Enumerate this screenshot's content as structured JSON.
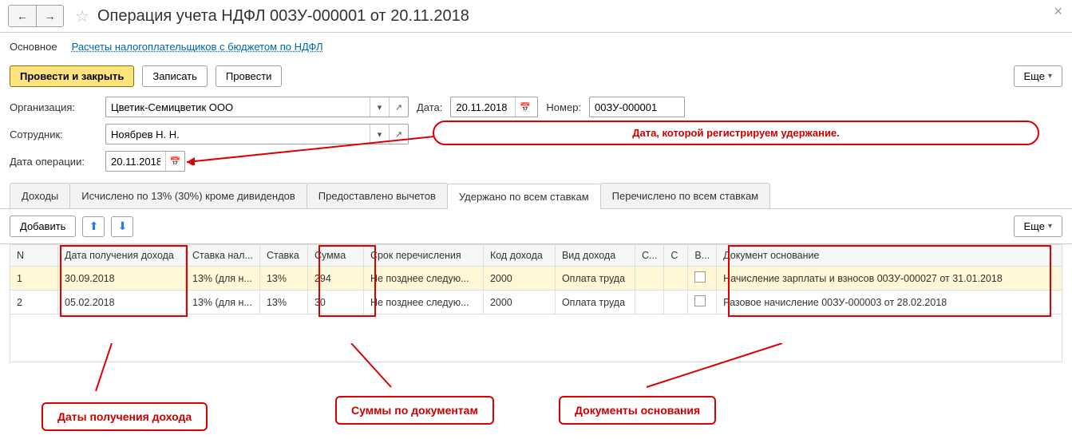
{
  "header": {
    "title": "Операция учета НДФЛ 00ЗУ-000001 от 20.11.2018"
  },
  "nav": {
    "main": "Основное",
    "link": "Расчеты налогоплательщиков с бюджетом по НДФЛ"
  },
  "toolbar": {
    "post_close": "Провести и закрыть",
    "save": "Записать",
    "post": "Провести",
    "more": "Еще"
  },
  "form": {
    "org_label": "Организация:",
    "org_value": "Цветик-Семицветик ООО",
    "date_label": "Дата:",
    "date_value": "20.11.2018",
    "num_label": "Номер:",
    "num_value": "00ЗУ-000001",
    "emp_label": "Сотрудник:",
    "emp_value": "Ноябрев Н. Н.",
    "opdate_label": "Дата операции:",
    "opdate_value": "20.11.2018"
  },
  "tabs": {
    "t1": "Доходы",
    "t2": "Исчислено по 13% (30%) кроме дивидендов",
    "t3": "Предоставлено вычетов",
    "t4": "Удержано по всем ставкам",
    "t5": "Перечислено по всем ставкам"
  },
  "tbltbar": {
    "add": "Добавить",
    "more": "Еще"
  },
  "columns": {
    "n": "N",
    "date": "Дата получения дохода",
    "rate": "Ставка нал...",
    "rate2": "Ставка",
    "sum": "Сумма",
    "srok": "Срок перечисления",
    "kod": "Код дохода",
    "vid": "Вид дохода",
    "s": "С...",
    "c": "С",
    "v": "В...",
    "doc": "Документ основание"
  },
  "rows": [
    {
      "n": "1",
      "date": "30.09.2018",
      "rate": "13% (для н...",
      "rate2": "13%",
      "sum": "294",
      "srok": "Не позднее следую...",
      "kod": "2000",
      "vid": "Оплата труда",
      "doc": "Начисление зарплаты и взносов 00ЗУ-000027 от 31.01.2018"
    },
    {
      "n": "2",
      "date": "05.02.2018",
      "rate": "13% (для н...",
      "rate2": "13%",
      "sum": "30",
      "srok": "Не позднее следую...",
      "kod": "2000",
      "vid": "Оплата труда",
      "doc": "Разовое начисление 00ЗУ-000003 от 28.02.2018"
    }
  ],
  "annotations": {
    "a1": "Дата, которой регистрируем удержание.",
    "a2": "Даты получения дохода",
    "a3": "Суммы по документам",
    "a4": "Документы основания"
  }
}
